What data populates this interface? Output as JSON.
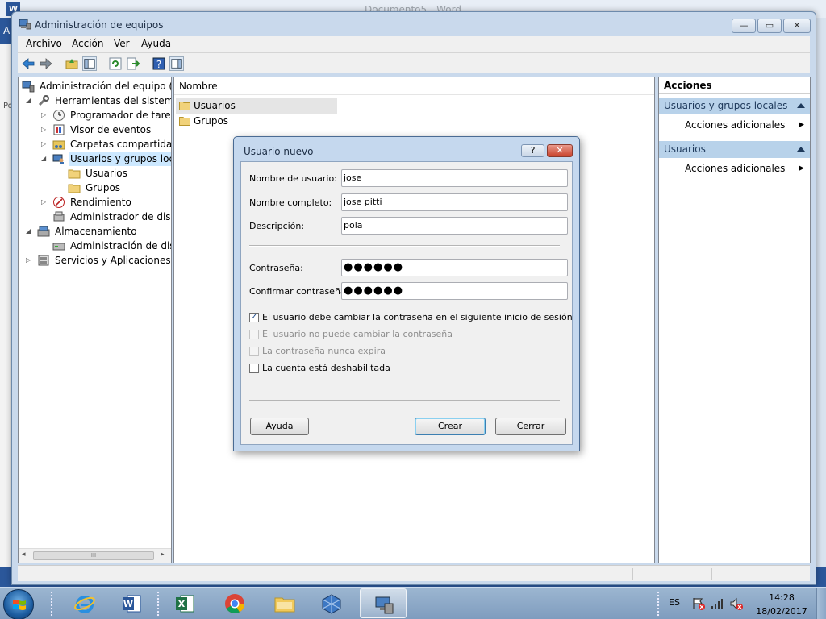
{
  "background": {
    "word_title": "Documento5 - Word",
    "word_logo": "W",
    "word_side_letter": "A",
    "word_side_letter2": "Po"
  },
  "window": {
    "title": "Administración de equipos",
    "min_glyph": "—",
    "max_glyph": "▭",
    "close_glyph": "✕"
  },
  "menu": [
    "Archivo",
    "Acción",
    "Ver",
    "Ayuda"
  ],
  "tree": {
    "root": "Administración del equipo (local)",
    "system_tools": "Herramientas del sistema",
    "task_scheduler": "Programador de tareas",
    "event_viewer": "Visor de eventos",
    "shared_folders": "Carpetas compartidas",
    "local_users": "Usuarios y grupos locales",
    "users": "Usuarios",
    "groups": "Grupos",
    "performance": "Rendimiento",
    "device_manager": "Administrador de dispositivos",
    "storage": "Almacenamiento",
    "disk_management": "Administración de discos",
    "services": "Servicios y Aplicaciones",
    "scroll_thumb": "III"
  },
  "list": {
    "column": "Nombre",
    "rows": [
      "Usuarios",
      "Grupos"
    ]
  },
  "actions": {
    "title": "Acciones",
    "group1": "Usuarios y grupos locales",
    "group1_item": "Acciones adicionales",
    "group2": "Usuarios",
    "group2_item": "Acciones adicionales"
  },
  "dialog": {
    "title": "Usuario nuevo",
    "help_glyph": "?",
    "close_glyph": "✕",
    "username_label": "Nombre de usuario:",
    "username_value": "jose",
    "fullname_label": "Nombre completo:",
    "fullname_value": "jose pitti",
    "description_label": "Descripción:",
    "description_value": "pola",
    "password_label": "Contraseña:",
    "password_value": "●●●●●●",
    "confirm_label": "Confirmar contraseña:",
    "confirm_value": "●●●●●●",
    "chk_must_change": "El usuario debe cambiar la contraseña en el siguiente inicio de sesión",
    "chk_must_change_checked": true,
    "chk_cannot_change": "El usuario no puede cambiar la contraseña",
    "chk_never_expires": "La contraseña nunca expira",
    "chk_disabled": "La cuenta está deshabilitada",
    "checkmark": "✓",
    "btn_help": "Ayuda",
    "btn_create": "Crear",
    "btn_close": "Cerrar"
  },
  "taskbar": {
    "apps": [
      "internet-explorer",
      "word",
      "excel",
      "chrome",
      "file-explorer",
      "virtualbox",
      "computer-management"
    ],
    "language": "ES",
    "time": "14:28",
    "date": "18/02/2017"
  }
}
